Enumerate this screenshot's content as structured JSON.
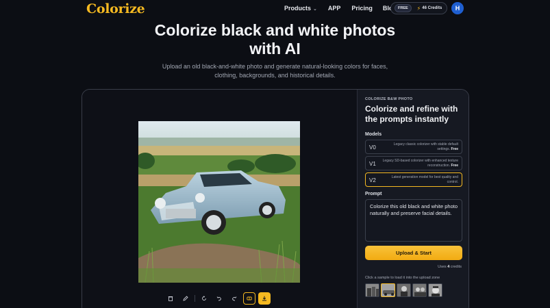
{
  "nav": {
    "logo": "Colorize",
    "links": {
      "products": "Products",
      "app": "APP",
      "pricing": "Pricing",
      "blog": "Blog"
    },
    "free_badge": "FREE",
    "credits": "46 Credits",
    "avatar_initial": "H"
  },
  "hero": {
    "title_line1": "Colorize black and white photos",
    "title_line2": "with AI",
    "subtitle_line1": "Upload an old black-and-white photo and generate natural-looking colors for faces,",
    "subtitle_line2": "clothing, backgrounds, and historical details."
  },
  "toolbar": {
    "icons": [
      "trash-icon",
      "pencil-icon",
      "rotate-icon",
      "undo-icon",
      "redo-icon",
      "compare-icon",
      "download-icon"
    ]
  },
  "side": {
    "kicker": "COLORIZE B&W PHOTO",
    "title": "Colorize and refine with the prompts instantly",
    "models_label": "Models",
    "models": [
      {
        "version": "V0",
        "desc": "Legacy classic colorizer with stable default settings.",
        "tag": "Free"
      },
      {
        "version": "V1",
        "desc": "Legacy SD-based colorizer with enhanced texture reconstruction.",
        "tag": "Free"
      },
      {
        "version": "V2",
        "desc": "Latest generation model for best quality and control.",
        "tag": ""
      }
    ],
    "prompt_label": "Prompt",
    "prompt_value": "Colorize this old black and white photo naturally and preserve facial details.",
    "start_button": "Upload & Start",
    "uses_prefix": "Uses ",
    "uses_value": "4",
    "uses_suffix": " credits",
    "sample_hint": "Click a sample to load it into the upload zone"
  },
  "colors": {
    "accent": "#f5b921",
    "background": "#0c0e14",
    "panel": "#161922",
    "avatar": "#1f5fd1"
  }
}
